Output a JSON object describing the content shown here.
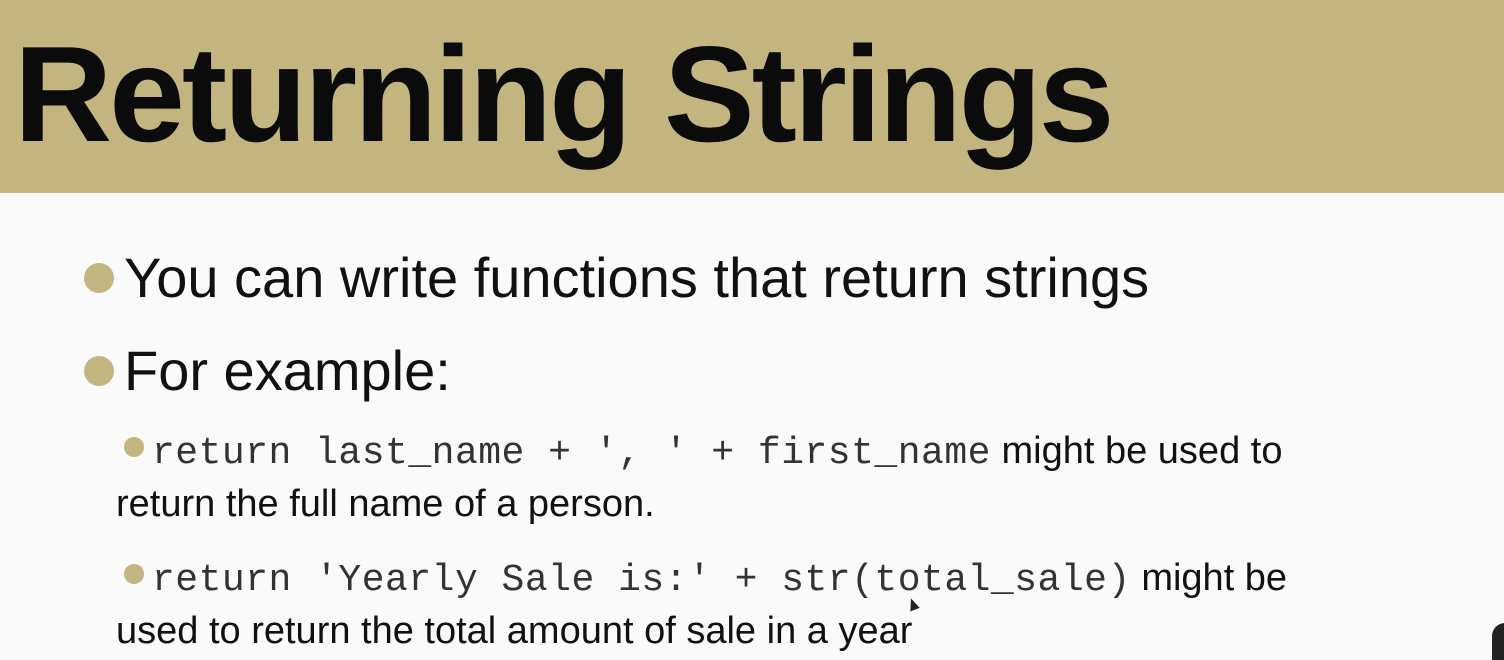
{
  "slide": {
    "title": "Returning Strings",
    "accent_color": "#c2b57f",
    "bullets": [
      {
        "text": "You can write functions that return strings"
      },
      {
        "text": "For example:"
      }
    ],
    "sub_bullets": [
      {
        "code": "return last_name + ', ' + first_name",
        "text_after": " might be used to",
        "text_line2": "return the full name of a person."
      },
      {
        "code": "return 'Yearly Sale is:' + str(total_sale)",
        "text_after": " might be",
        "text_line2": "used to return the total amount of sale in a year"
      }
    ]
  }
}
